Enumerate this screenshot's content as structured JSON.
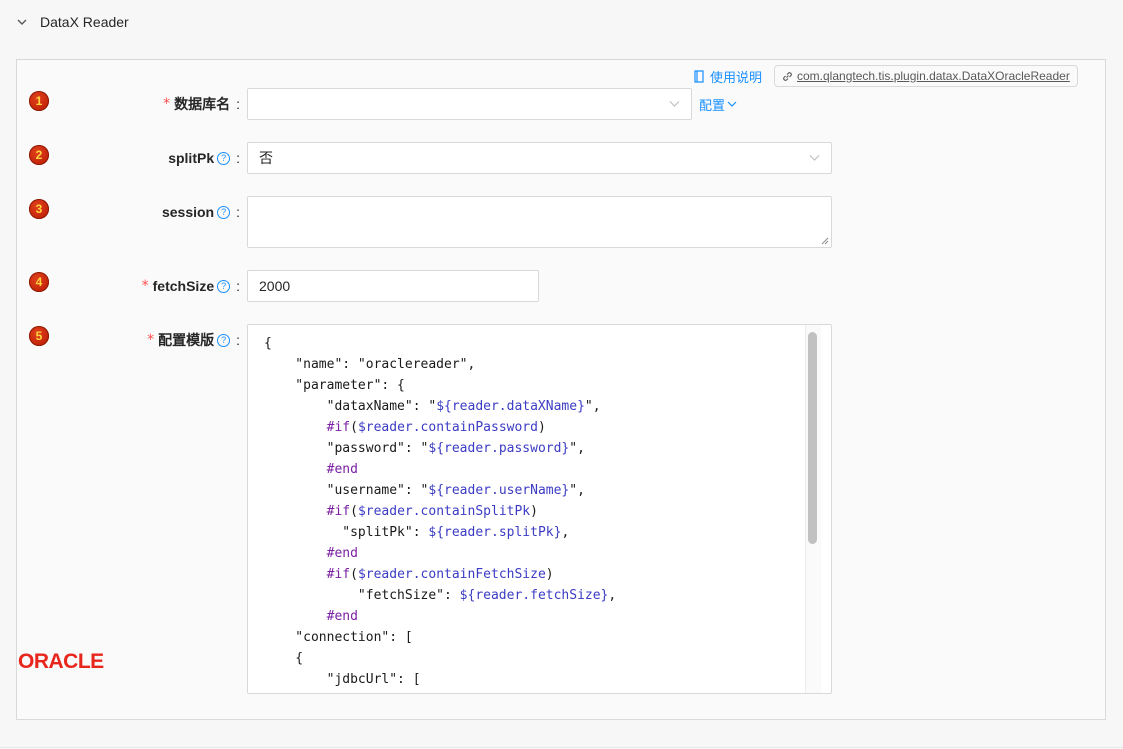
{
  "section": {
    "title": "DataX Reader"
  },
  "doc_link": {
    "label": "使用说明"
  },
  "plugin_class": {
    "label": "com.qlangtech.tis.plugin.datax.DataXOracleReader"
  },
  "steps": [
    "1",
    "2",
    "3",
    "4",
    "5"
  ],
  "fields": {
    "dbname": {
      "label": "数据库名",
      "required": true,
      "value": "",
      "config_label": "配置"
    },
    "splitpk": {
      "label": "splitPk",
      "required": false,
      "value": "否"
    },
    "session": {
      "label": "session",
      "required": false,
      "value": ""
    },
    "fetchsize": {
      "label": "fetchSize",
      "required": true,
      "value": "2000"
    },
    "template": {
      "label": "配置模版",
      "required": true
    }
  },
  "template_lines": [
    "{",
    "    \"name\": \"oraclereader\",",
    "    \"parameter\": {",
    "        \"dataxName\": \"${reader.dataXName}\",",
    "        #if($reader.containPassword)",
    "        \"password\": \"${reader.password}\",",
    "        #end",
    "        \"username\": \"${reader.userName}\",",
    "        #if($reader.containSplitPk)",
    "          \"splitPk\": ${reader.splitPk},",
    "        #end",
    "        #if($reader.containFetchSize)",
    "            \"fetchSize\": ${reader.fetchSize},",
    "        #end",
    "    \"connection\": [",
    "    {",
    "        \"jdbcUrl\": ["
  ],
  "logo": {
    "text": "ORACLE",
    "color": "#e8261b"
  },
  "colors": {
    "accent": "#1890ff",
    "required": "#ff4d4f",
    "step_badge": "#c4230a"
  }
}
